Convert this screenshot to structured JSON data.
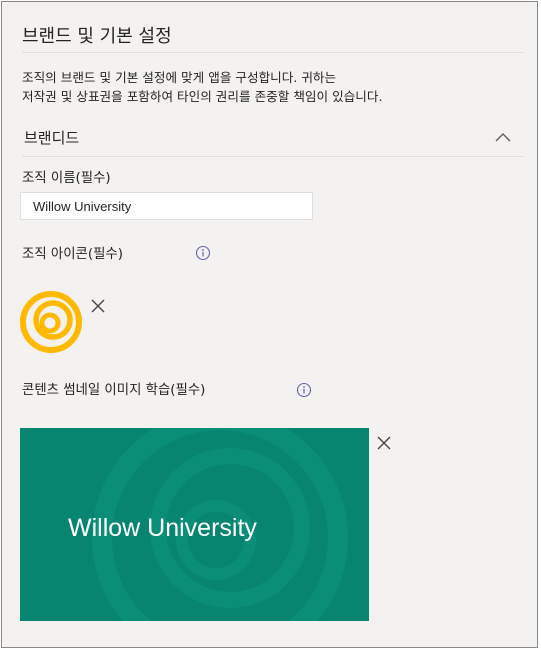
{
  "header": {
    "title": "브랜드 및 기본 설정",
    "description_line1": "조직의 브랜드 및 기본 설정에 맞게 앱을 구성합니다. 귀하는",
    "description_line2": "저작권 및 상표권을 포함하여 타인의 권리를 존중할 책임이 있습니다."
  },
  "branding": {
    "section_label": "브랜디드",
    "org_name_label": "조직 이름(필수)",
    "org_name_value": "Willow University",
    "org_icon_label": "조직 아이콘(필수)",
    "thumbnail_label": "콘텐츠 썸네일 이미지 학습(필수)",
    "thumbnail_text": "Willow University"
  },
  "colors": {
    "background": "#f3f2f1",
    "thumbnail_bg": "#078570",
    "logo": "#ffb900",
    "info_icon": "#6264a7"
  },
  "icons": [
    "chevron-up-icon",
    "info-icon",
    "close-icon",
    "logo-icon"
  ]
}
